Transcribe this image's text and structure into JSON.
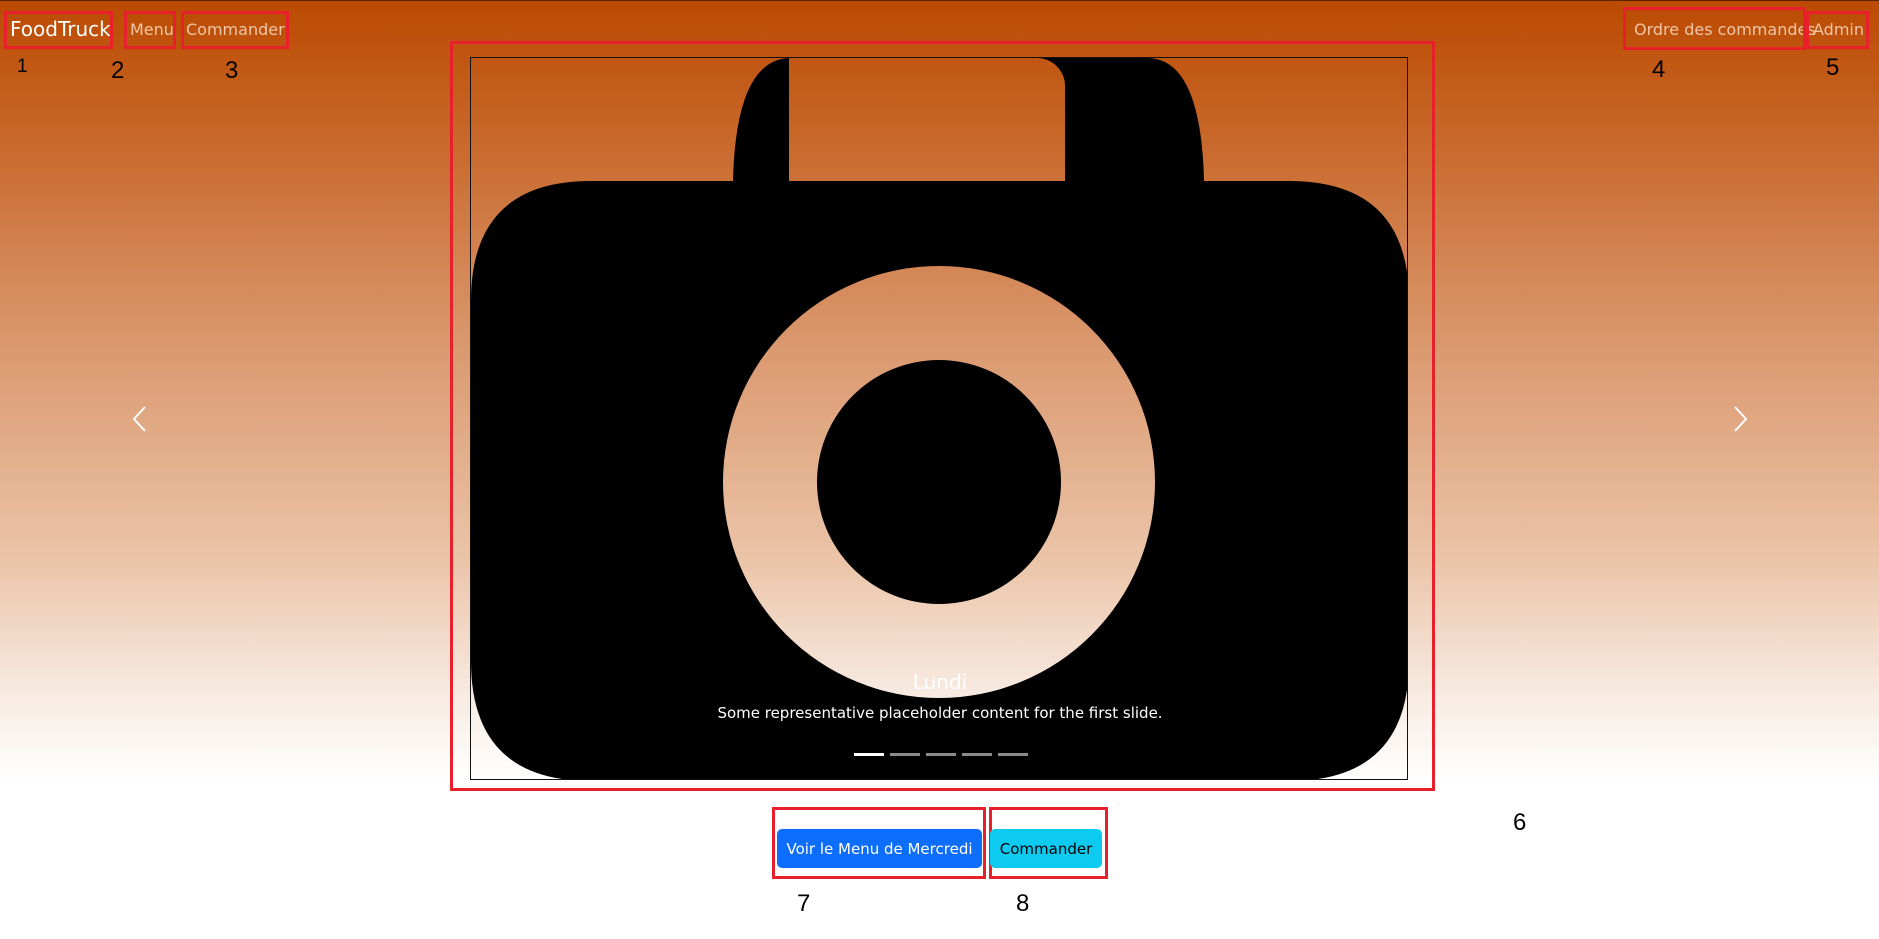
{
  "navbar": {
    "brand": "FoodTruck",
    "links": [
      "Menu",
      "Commander"
    ],
    "right_links": [
      "Ordre des commandes",
      "Admin"
    ]
  },
  "annotations": [
    "1",
    "2",
    "3",
    "4",
    "5",
    "6",
    "7",
    "8"
  ],
  "carousel": {
    "caption_title": "Lundi",
    "caption_text": "Some representative placeholder content for the first slide.",
    "indicator_count": 5,
    "active_index": 0
  },
  "buttons": {
    "primary": "Voir le Menu de Mercredi",
    "secondary": "Commander"
  },
  "colors": {
    "highlight": "#e8202b",
    "primary": "#0d6efd",
    "info": "#0dcaf0",
    "header": "#bb4a00"
  }
}
